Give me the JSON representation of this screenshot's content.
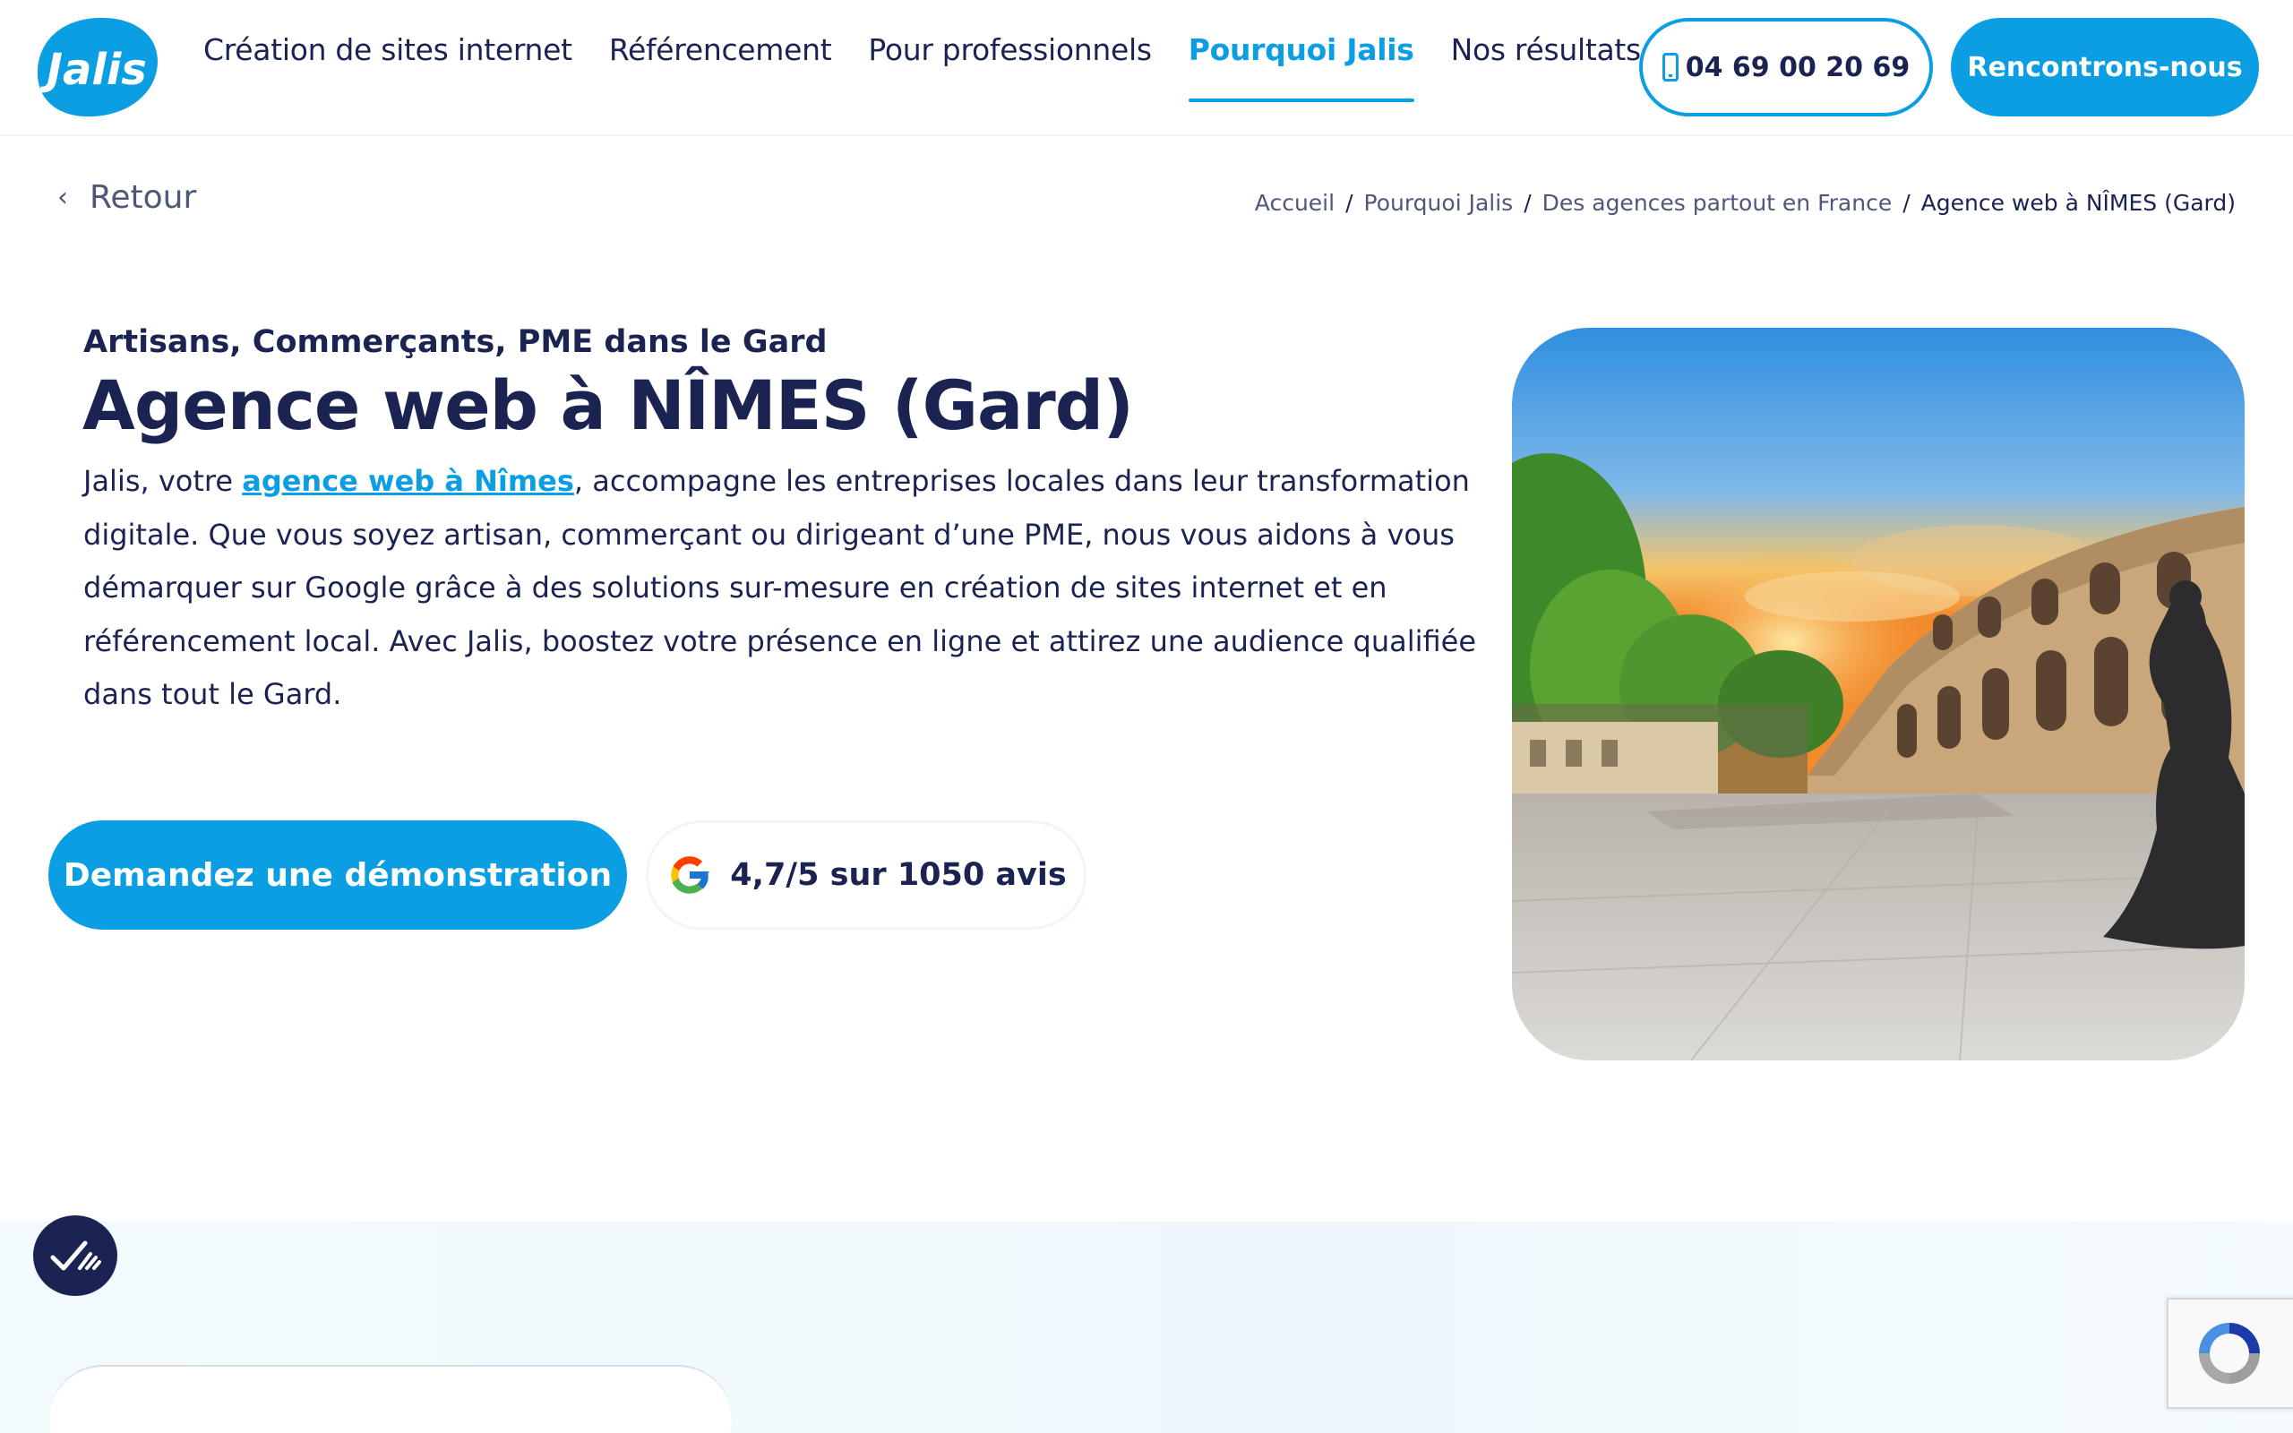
{
  "header": {
    "logo_text": "Jalis",
    "nav": [
      {
        "label": "Création de sites internet",
        "active": false
      },
      {
        "label": "Référencement",
        "active": false
      },
      {
        "label": "Pour professionnels",
        "active": false
      },
      {
        "label": "Pourquoi Jalis",
        "active": true
      },
      {
        "label": "Nos résultats",
        "active": false
      }
    ],
    "phone": "04 69 00 20 69",
    "cta": "Rencontrons-nous"
  },
  "back_label": "Retour",
  "breadcrumb": {
    "items": [
      "Accueil",
      "Pourquoi Jalis",
      "Des agences partout en France"
    ],
    "current": "Agence web à NÎMES (Gard)",
    "separator": "/"
  },
  "hero": {
    "kicker": "Artisans, Commerçants, PME dans le Gard",
    "title": "Agence web à NÎMES (Gard)",
    "desc_before": "Jalis, votre ",
    "desc_link": "agence web à Nîmes",
    "desc_after": ", accompagne les entreprises locales dans leur transformation digitale. Que vous soyez artisan, commerçant ou dirigeant d’une PME, nous vous aidons à vous démarquer sur Google grâce à des solutions sur-mesure en création de sites internet et en référencement local. Avec Jalis, boostez votre présence en ligne et attirez une audience qualifiée dans tout le Gard.",
    "demo_button": "Demandez une démonstration",
    "reviews": "4,7/5 sur 1050 avis"
  },
  "icons": {
    "back": "chevron-left-icon",
    "phone": "mobile-phone-icon",
    "google": "google-icon",
    "accessibility": "accessibility-icon",
    "recaptcha": "recaptcha-icon"
  },
  "colors": {
    "brand_blue": "#0b9ee3",
    "navy": "#1b2352",
    "muted": "#4e5878"
  }
}
